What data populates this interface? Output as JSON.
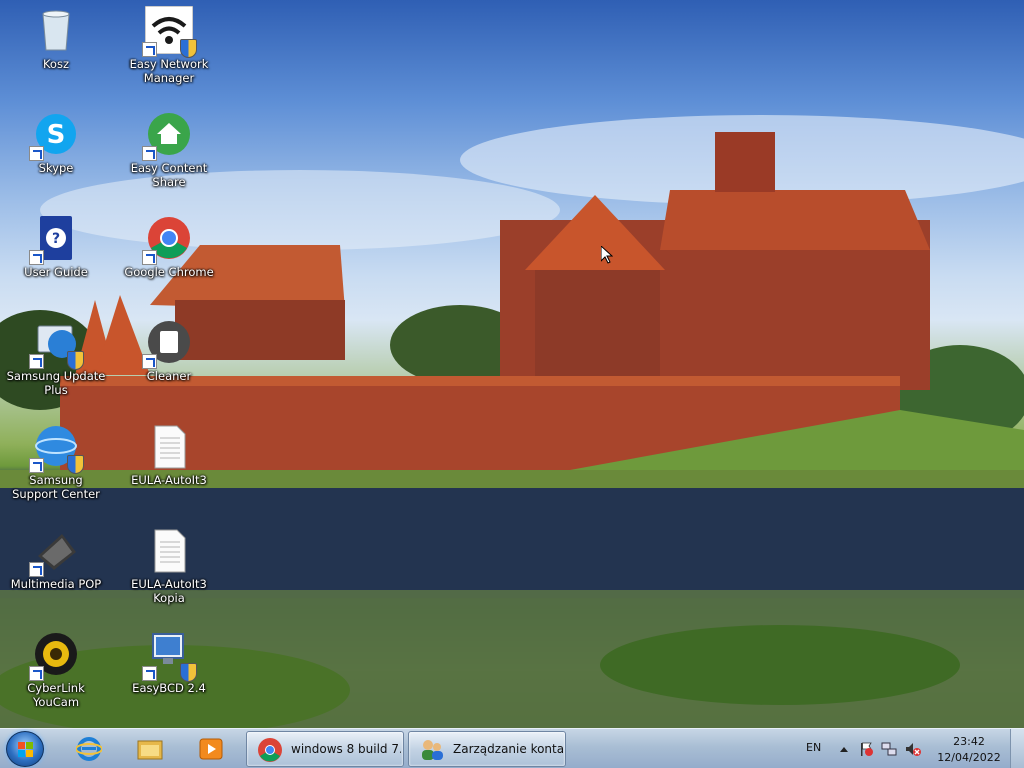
{
  "desktop_icons": [
    {
      "label": "Kosz",
      "icon": "recycle-bin-icon"
    },
    {
      "label": "Easy Network Manager",
      "icon": "wifi-icon"
    },
    {
      "label": "Skype",
      "icon": "skype-icon"
    },
    {
      "label": "Easy Content Share",
      "icon": "content-share-icon"
    },
    {
      "label": "User Guide",
      "icon": "help-book-icon"
    },
    {
      "label": "Google Chrome",
      "icon": "chrome-icon"
    },
    {
      "label": "Samsung Update Plus",
      "icon": "samsung-update-icon"
    },
    {
      "label": "Cleaner",
      "icon": "cleaner-icon"
    },
    {
      "label": "Samsung Support Center",
      "icon": "samsung-support-icon"
    },
    {
      "label": "EULA-AutoIt3",
      "icon": "text-file-icon"
    },
    {
      "label": "Multimedia POP",
      "icon": "multimedia-icon"
    },
    {
      "label": "EULA-AutoIt3 Kopia",
      "icon": "text-file-icon"
    },
    {
      "label": "CyberLink YouCam",
      "icon": "webcam-icon"
    },
    {
      "label": "EasyBCD 2.4",
      "icon": "easybcd-icon"
    }
  ],
  "taskbar": {
    "pinned": [
      "internet-explorer-icon",
      "file-explorer-icon",
      "media-player-icon"
    ],
    "tasks": [
      {
        "title": "windows 8 build 7...",
        "icon": "chrome-icon"
      },
      {
        "title": "Zarządzanie konta...",
        "icon": "users-icon"
      }
    ],
    "language": "EN",
    "time": "23:42",
    "date": "12/04/2022"
  },
  "colors": {
    "taskbar": "#a9bed4",
    "sky": "#5e8fd6",
    "brick": "#a8452c",
    "roof": "#c8552c"
  }
}
